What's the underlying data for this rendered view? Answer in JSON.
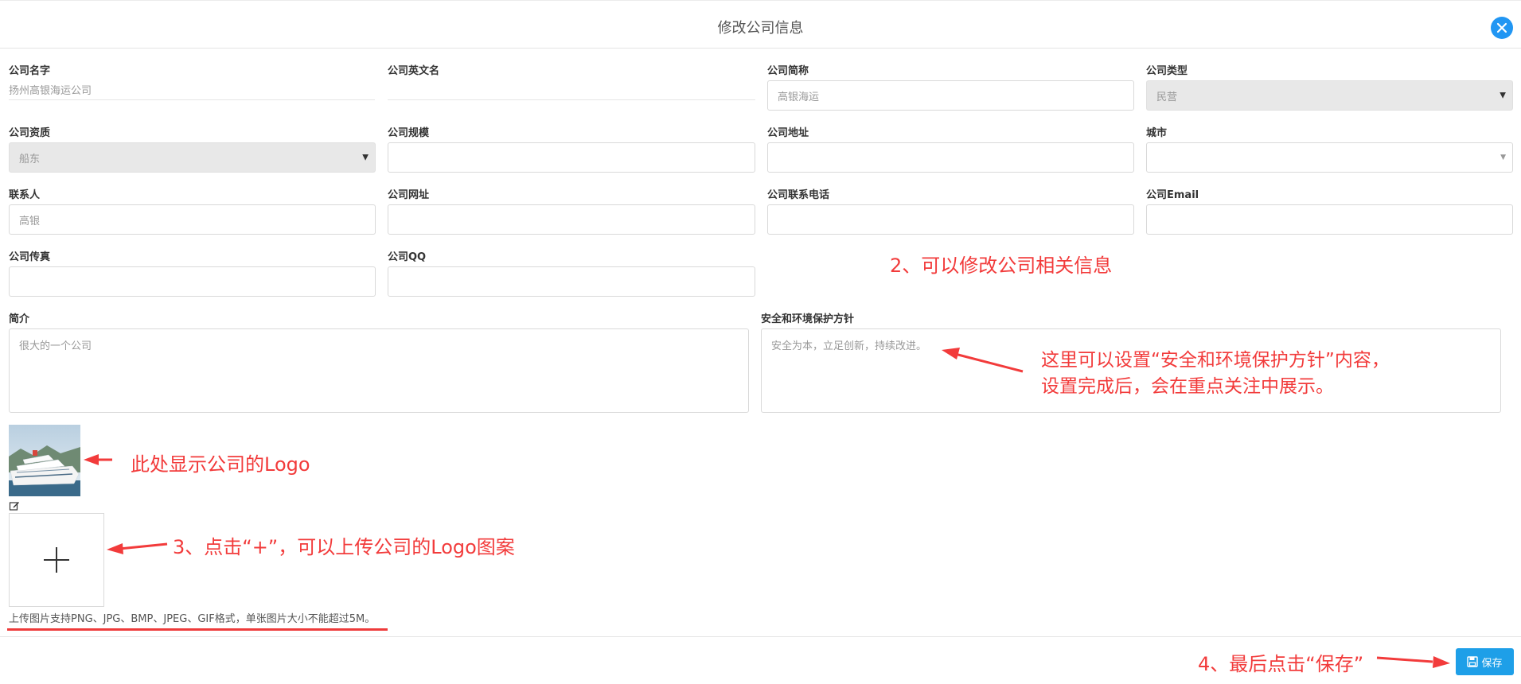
{
  "header": {
    "title": "修改公司信息"
  },
  "icons": {
    "close": "close-icon",
    "edit": "edit-icon",
    "plus": "plus-icon",
    "save": "save-icon"
  },
  "colors": {
    "accent": "#1e9fe8",
    "annotation": "#f23b3b"
  },
  "fields": {
    "company_name": {
      "label": "公司名字",
      "value": "扬州高银海运公司"
    },
    "company_english_name": {
      "label": "公司英文名",
      "value": ""
    },
    "company_short_name": {
      "label": "公司简称",
      "value": "高银海运"
    },
    "company_type": {
      "label": "公司类型",
      "value": "民营"
    },
    "company_qualification": {
      "label": "公司资质",
      "value": "船东"
    },
    "company_scale": {
      "label": "公司规模",
      "value": ""
    },
    "company_address": {
      "label": "公司地址",
      "value": ""
    },
    "city": {
      "label": "城市",
      "value": ""
    },
    "contact": {
      "label": "联系人",
      "value": "高银"
    },
    "website": {
      "label": "公司网址",
      "value": ""
    },
    "phone": {
      "label": "公司联系电话",
      "value": ""
    },
    "email": {
      "label": "公司Email",
      "value": ""
    },
    "fax": {
      "label": "公司传真",
      "value": ""
    },
    "qq": {
      "label": "公司QQ",
      "value": ""
    },
    "intro": {
      "label": "简介",
      "value": "很大的一个公司"
    },
    "safety_policy": {
      "label": "安全和环境保护方针",
      "value": "安全为本，立足创新，持续改进。"
    }
  },
  "upload": {
    "hint": "上传图片支持PNG、JPG、BMP、JPEG、GIF格式，单张图片大小不能超过5M。"
  },
  "footer": {
    "save_label": "保存"
  },
  "annotations": {
    "step2": "2、可以修改公司相关信息",
    "policy_line1": "这里可以设置“安全和环境保护方针”内容，",
    "policy_line2": "设置完成后，会在重点关注中展示。",
    "logo": "此处显示公司的Logo",
    "step3": "3、点击“+”，可以上传公司的Logo图案",
    "step4": "4、最后点击“保存”"
  }
}
